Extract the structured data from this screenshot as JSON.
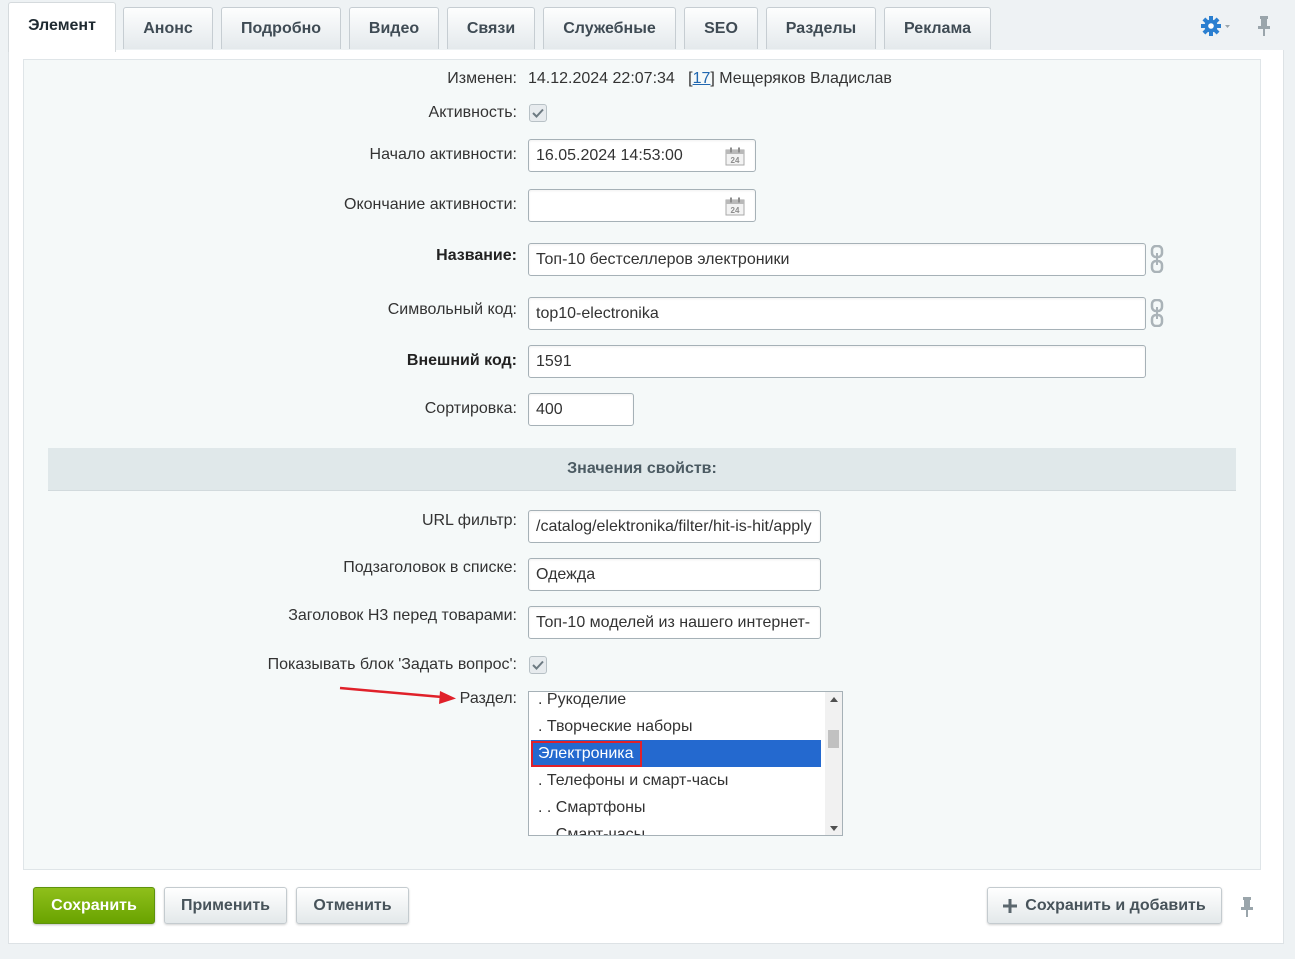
{
  "tabs": [
    "Элемент",
    "Анонс",
    "Подробно",
    "Видео",
    "Связи",
    "Служебные",
    "SEO",
    "Разделы",
    "Реклама"
  ],
  "modified": {
    "label": "Изменен:",
    "date": "14.12.2024 22:07:34",
    "user_id": "17",
    "user_name": "Мещеряков Владислав"
  },
  "fields": {
    "active": {
      "label": "Активность:",
      "checked": true
    },
    "active_from": {
      "label": "Начало активности:",
      "value": "16.05.2024 14:53:00"
    },
    "active_to": {
      "label": "Окончание активности:",
      "value": ""
    },
    "name": {
      "label": "Название:",
      "value": "Топ-10 бестселлеров электроники"
    },
    "code": {
      "label": "Символьный код:",
      "value": "top10-electronika"
    },
    "xml_id": {
      "label": "Внешний код:",
      "value": "1591"
    },
    "sort": {
      "label": "Сортировка:",
      "value": "400"
    }
  },
  "properties": {
    "title": "Значения свойств:",
    "url_filter": {
      "label": "URL фильтр:",
      "value": "/catalog/elektronika/filter/hit-is-hit/apply"
    },
    "subtitle": {
      "label": "Подзаголовок в списке:",
      "value": "Одежда"
    },
    "h3": {
      "label": "Заголовок Н3 перед товарами:",
      "value": "Топ-10 моделей из нашего интернет-"
    },
    "ask_block": {
      "label": "Показывать блок 'Задать вопрос':",
      "checked": true
    },
    "section": {
      "label": "Раздел:",
      "options": [
        ". Рукоделие",
        ". Творческие наборы",
        "Электроника",
        ". Телефоны и смарт-часы",
        ". . Смартфоны",
        ". . Смарт-часы"
      ],
      "selected": "Электроника"
    }
  },
  "buttons": {
    "save": "Сохранить",
    "apply": "Применить",
    "cancel": "Отменить",
    "save_add": "Сохранить и добавить",
    "save_add_icon": "plus-icon"
  },
  "colors": {
    "accent_green": "#75ad0a",
    "selection": "#2469cf",
    "annotation_red": "#e0212a",
    "link": "#2067b0"
  }
}
